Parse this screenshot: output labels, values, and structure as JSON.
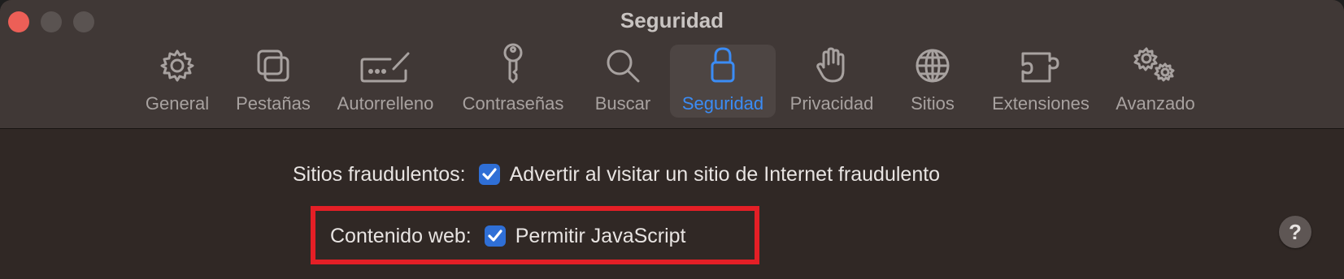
{
  "window": {
    "title": "Seguridad"
  },
  "toolbar": {
    "tabs": [
      {
        "label": "General",
        "icon": "gear-icon"
      },
      {
        "label": "Pestañas",
        "icon": "tabs-icon"
      },
      {
        "label": "Autorrelleno",
        "icon": "autofill-icon"
      },
      {
        "label": "Contraseñas",
        "icon": "key-icon"
      },
      {
        "label": "Buscar",
        "icon": "magnifier-icon"
      },
      {
        "label": "Seguridad",
        "icon": "lock-icon",
        "selected": true
      },
      {
        "label": "Privacidad",
        "icon": "hand-icon"
      },
      {
        "label": "Sitios",
        "icon": "globe-icon"
      },
      {
        "label": "Extensiones",
        "icon": "puzzle-icon"
      },
      {
        "label": "Avanzado",
        "icon": "gears-icon"
      }
    ]
  },
  "settings": {
    "fraud": {
      "label": "Sitios fraudulentos:",
      "option": "Advertir al visitar un sitio de Internet fraudulento",
      "checked": true
    },
    "web": {
      "label": "Contenido web:",
      "option": "Permitir JavaScript",
      "checked": true
    }
  },
  "help": {
    "label": "?"
  },
  "colors": {
    "accent": "#3b8cf5",
    "highlight": "#e41f26",
    "checkbox": "#2f6fd6"
  }
}
